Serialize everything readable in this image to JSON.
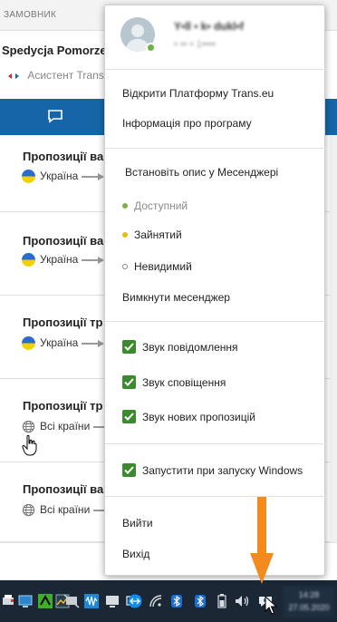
{
  "app": {
    "header_label": "ЗАМОВНИК",
    "company_name": "Spedycja Pomorze I",
    "assistant_label": "Асистент Trans.",
    "offers": [
      {
        "title": "Пропозиції ва",
        "route_from": "Україна",
        "flag": "ua"
      },
      {
        "title": "Пропозиції ва",
        "route_from": "Україна",
        "flag": "ua"
      },
      {
        "title": "Пропозиції тр",
        "route_from": "Україна",
        "flag": "ua"
      },
      {
        "title": "Пропозиції тр",
        "route_from": "Всі країни",
        "flag": "globe"
      },
      {
        "title": "Пропозиції ва",
        "route_from": "Всі країни",
        "flag": "globe"
      }
    ]
  },
  "menu": {
    "user": {
      "name": "Y•ll • k• dukl•f",
      "id": "• •• • 1••••"
    },
    "open_platform": "Відкрити Платформу Trans.eu",
    "program_info": "Інформація про програму",
    "set_description": "Встановіть опис у Месенджері",
    "status_available": "Доступний",
    "status_busy": "Зайнятий",
    "status_invisible": "Невидимий",
    "disable_messenger": "Вимкнути месенджер",
    "sound_message": "Звук повідомлення",
    "sound_notification": "Звук сповіщення",
    "sound_new_offers": "Звук нових пропозицій",
    "start_with_windows": "Запустити при запуску Windows",
    "logout": "Вийти",
    "exit": "Вихід"
  },
  "colors": {
    "available": "#7fae4f",
    "busy": "#e8b81c",
    "invisible": "#888888",
    "checkbox": "#3c8a2e",
    "app_bar": "#1565a8",
    "annotation_arrow": "#f28a1d"
  },
  "taskbar": {
    "time": "14:28",
    "date": "27.05.2020",
    "icons": [
      "printer-icon",
      "monitor-icon",
      "app-icon",
      "graph-icon",
      "mute-icon",
      "waveform-icon",
      "pc-icon",
      "display-icon",
      "teamviewer-icon",
      "wifi-icon",
      "bluetooth-icon",
      "bluetooth-icon",
      "battery-icon",
      "volume-icon",
      "messenger-icon"
    ]
  }
}
